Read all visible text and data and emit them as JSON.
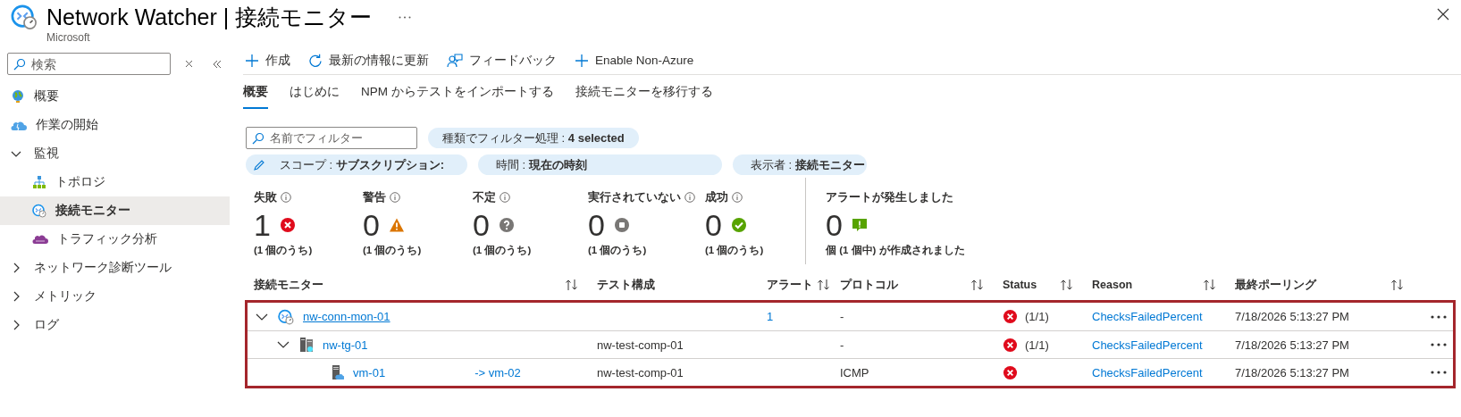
{
  "header": {
    "title": "Network Watcher | 接続モニター",
    "subtitle": "Microsoft"
  },
  "sidebar": {
    "search": {
      "placeholder": "検索"
    },
    "items": [
      {
        "label": "概要",
        "kind": "globe",
        "selected": false
      },
      {
        "label": "作業の開始",
        "kind": "cloud",
        "selected": false
      },
      {
        "label": "監視",
        "kind": "group",
        "expanded": true,
        "selected": false,
        "children": [
          {
            "label": "トポロジ",
            "kind": "topology",
            "selected": false
          },
          {
            "label": "接続モニター",
            "kind": "monitor",
            "selected": true
          },
          {
            "label": "トラフィック分析",
            "kind": "traffic",
            "selected": false
          }
        ]
      },
      {
        "label": "ネットワーク診断ツール",
        "kind": "group",
        "expanded": false,
        "selected": false
      },
      {
        "label": "メトリック",
        "kind": "group",
        "expanded": false,
        "selected": false
      },
      {
        "label": "ログ",
        "kind": "group",
        "expanded": false,
        "selected": false
      }
    ]
  },
  "toolbar": [
    {
      "label": "作成",
      "kind": "plus"
    },
    {
      "label": "最新の情報に更新",
      "kind": "refresh"
    },
    {
      "label": "フィードバック",
      "kind": "feedback"
    },
    {
      "label": "Enable Non-Azure",
      "kind": "plus"
    }
  ],
  "tabs": [
    {
      "label": "概要",
      "selected": true
    },
    {
      "label": "はじめに",
      "selected": false
    },
    {
      "label": "NPM からテストをインポートする",
      "selected": false
    },
    {
      "label": "接続モニターを移行する",
      "selected": false
    }
  ],
  "filters": {
    "search": {
      "placeholder": "名前でフィルター"
    },
    "pills": [
      {
        "text": "種類でフィルター処理 : **4 selected**",
        "kind": "plain"
      },
      {
        "text": "スコープ : **サブスクリプション:**",
        "kind": "edit"
      },
      {
        "text": "時間 : **現在の時刻**",
        "kind": "plain"
      },
      {
        "text": "表示者 : **接続モニター**",
        "kind": "plain"
      }
    ]
  },
  "summary": [
    {
      "label": "失敗",
      "count": "1",
      "kind": "failed",
      "note": "(1 個のうち)"
    },
    {
      "label": "警告",
      "count": "0",
      "kind": "warning",
      "note": "(1 個のうち)"
    },
    {
      "label": "不定",
      "count": "0",
      "kind": "unknown",
      "note": "(1 個のうち)"
    },
    {
      "label": "実行されていない",
      "count": "0",
      "kind": "stopped",
      "note": "(1 個のうち)"
    },
    {
      "label": "成功",
      "count": "0",
      "kind": "success",
      "note": "(1 個のうち)"
    }
  ],
  "alerts": {
    "label": "アラートが発生しました",
    "count": "0",
    "note": "個 (1 個中) が作成されました"
  },
  "table": {
    "annotation_box": true,
    "columns": [
      {
        "label": "接続モニター",
        "sortable": true
      },
      {
        "label": "テスト構成",
        "sortable": false
      },
      {
        "label": "アラート",
        "sortable": true
      },
      {
        "label": "プロトコル",
        "sortable": true
      },
      {
        "label": "Status",
        "sortable": true
      },
      {
        "label": "Reason",
        "sortable": true
      },
      {
        "label": "最終ポーリング",
        "sortable": true
      }
    ],
    "rows": [
      {
        "name": "nw-conn-mon-01",
        "kind": "monitor",
        "expanded": true,
        "alerts": "1",
        "protocol": "-",
        "failed": true,
        "status_count": "(1/1)",
        "reason": "ChecksFailedPercent",
        "last_polled": "7/18/2026 5:13:27 PM",
        "children": [
          {
            "name": "nw-tg-01",
            "kind": "group",
            "expanded": true,
            "test_config": "nw-test-comp-01",
            "protocol": "-",
            "failed": true,
            "status_count": "(1/1)",
            "reason": "ChecksFailedPercent",
            "last_polled": "7/18/2026 5:13:27 PM",
            "children": [
              {
                "name": "vm-01",
                "target": "-> vm-02",
                "kind": "vm",
                "test_config": "nw-test-comp-01",
                "protocol": "ICMP",
                "failed": true,
                "reason": "ChecksFailedPercent",
                "last_polled": "7/18/2026 5:13:27 PM"
              }
            ]
          }
        ]
      }
    ]
  }
}
